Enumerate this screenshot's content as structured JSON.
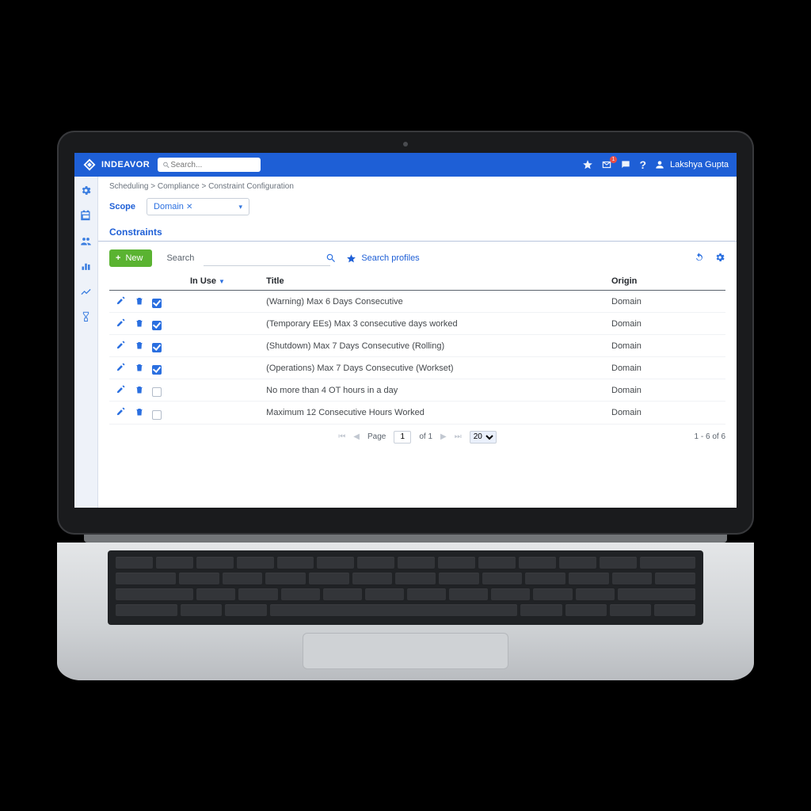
{
  "brand": "INDEAVOR",
  "search_placeholder": "Search...",
  "user_name": "Lakshya Gupta",
  "notification_count": "1",
  "breadcrumb": "Scheduling > Compliance > Constraint Configuration",
  "scope": {
    "label": "Scope",
    "value": "Domain"
  },
  "section_title": "Constraints",
  "toolbar": {
    "new_label": "New",
    "search_label": "Search",
    "profiles_label": "Search profiles"
  },
  "columns": {
    "in_use": "In Use",
    "title": "Title",
    "origin": "Origin"
  },
  "rows": [
    {
      "in_use": true,
      "title": "(Warning) Max 6 Days Consecutive",
      "origin": "Domain"
    },
    {
      "in_use": true,
      "title": "(Temporary EEs) Max 3 consecutive days worked",
      "origin": "Domain"
    },
    {
      "in_use": true,
      "title": "(Shutdown) Max 7 Days Consecutive (Rolling)",
      "origin": "Domain"
    },
    {
      "in_use": true,
      "title": "(Operations) Max 7 Days Consecutive (Workset)",
      "origin": "Domain"
    },
    {
      "in_use": false,
      "title": "No more than 4 OT hours in a day",
      "origin": "Domain"
    },
    {
      "in_use": false,
      "title": "Maximum 12 Consecutive Hours Worked",
      "origin": "Domain"
    }
  ],
  "pager": {
    "page_label": "Page",
    "page": "1",
    "of_label": "of 1",
    "page_size": "20",
    "range": "1 - 6 of 6"
  }
}
